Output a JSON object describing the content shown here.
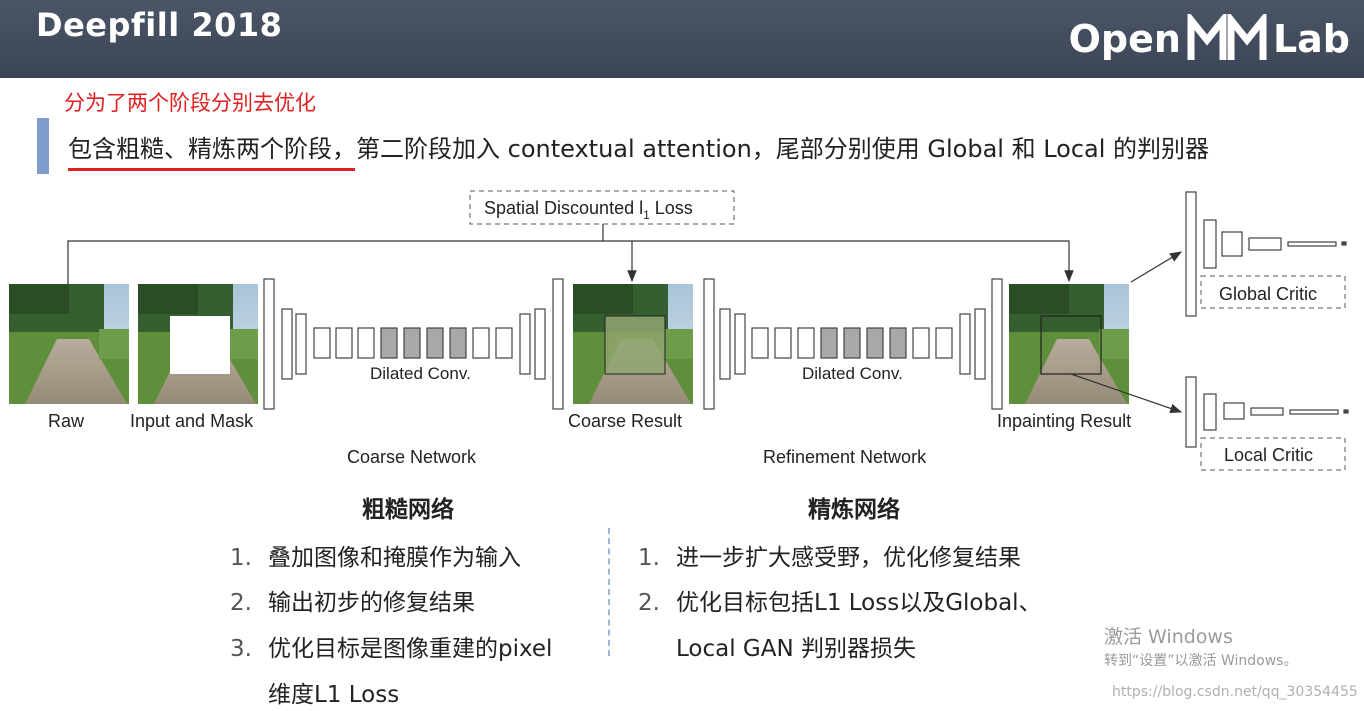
{
  "header": {
    "title": "Deepfill 2018",
    "logo_text_left": "Open",
    "logo_text_right": "Lab"
  },
  "note": "分为了两个阶段分别去优化",
  "subtitle": "包含粗糙、精炼两个阶段，第二阶段加入 contextual attention，尾部分别使用 Global 和 Local 的判别器",
  "diagram": {
    "loss_label": "Spatial Discounted l",
    "loss_sub": "1",
    "loss_suffix": " Loss",
    "labels": {
      "raw": "Raw",
      "input_mask": "Input and Mask",
      "coarse_result": "Coarse Result",
      "inpainting_result": "Inpainting Result",
      "dilated1": "Dilated Conv.",
      "dilated2": "Dilated Conv.",
      "coarse_network": "Coarse Network",
      "refinement_network": "Refinement Network",
      "global_critic": "Global Critic",
      "local_critic": "Local Critic"
    }
  },
  "left_column": {
    "title": "粗糙网络",
    "items": [
      {
        "num": "1.",
        "text": "叠加图像和掩膜作为输入"
      },
      {
        "num": "2.",
        "text": "输出初步的修复结果"
      },
      {
        "num": "3.",
        "text": "优化目标是图像重建的pixel"
      },
      {
        "num": "",
        "text": "维度L1 Loss"
      }
    ]
  },
  "right_column": {
    "title": "精炼网络",
    "items": [
      {
        "num": "1.",
        "text": "进一步扩大感受野，优化修复结果"
      },
      {
        "num": "2.",
        "text": "优化目标包括L1 Loss以及Global、"
      },
      {
        "num": "",
        "text": "Local GAN 判别器损失"
      }
    ]
  },
  "watermark": {
    "line1": "激活 Windows",
    "line2": "转到“设置”以激活 Windows。",
    "url": "https://blog.csdn.net/qq_30354455"
  }
}
